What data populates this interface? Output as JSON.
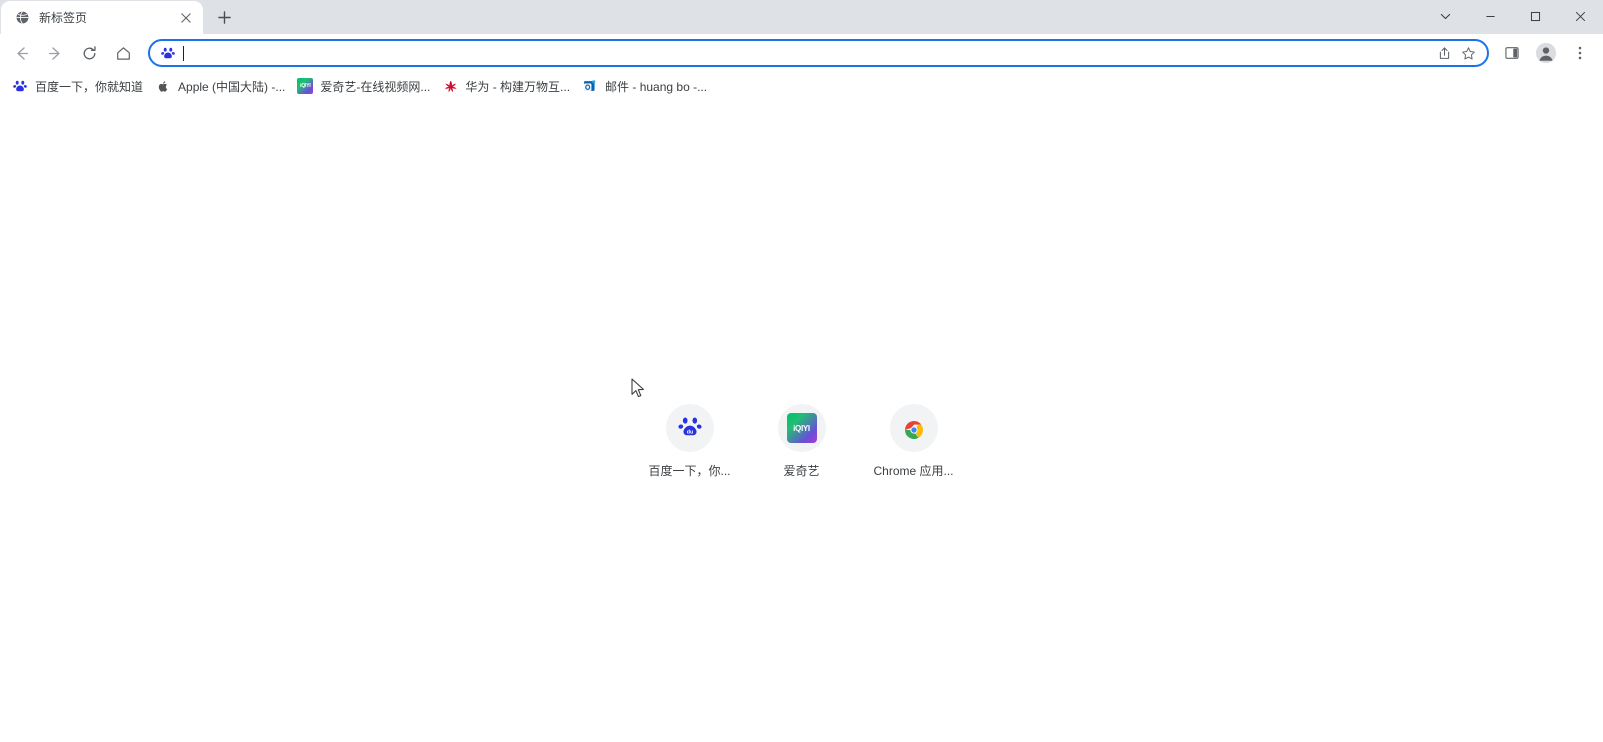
{
  "window": {
    "controls": {
      "tab_search": "tab-search-chevron",
      "minimize": "minimize",
      "maximize": "maximize",
      "close": "close"
    }
  },
  "tabstrip": {
    "tabs": [
      {
        "title": "新标签页",
        "favicon": "globe-icon",
        "active": true,
        "close_label": "×"
      }
    ],
    "new_tab_label": "+"
  },
  "toolbar": {
    "back_label": "←",
    "forward_label": "→",
    "reload_label": "⟳",
    "home_label": "⌂",
    "omnibox": {
      "value": "",
      "placeholder": "",
      "favicon": "baidu-paw-icon",
      "share_label": "share-icon",
      "bookmark_label": "star-icon"
    },
    "side_panel_label": "side-panel-icon",
    "profile_label": "profile-avatar-icon",
    "menu_label": "three-dot-menu-icon"
  },
  "bookmarks": [
    {
      "label": "百度一下，你就知道",
      "icon": "baidu-paw-icon"
    },
    {
      "label": "Apple (中国大陆) -...",
      "icon": "apple-icon"
    },
    {
      "label": "爱奇艺-在线视频网...",
      "icon": "iqiyi-icon"
    },
    {
      "label": "华为 - 构建万物互...",
      "icon": "huawei-icon"
    },
    {
      "label": "邮件 - huang bo -...",
      "icon": "outlook-icon"
    }
  ],
  "newtab": {
    "shortcuts": [
      {
        "label": "百度一下，你...",
        "icon": "baidu-paw-icon"
      },
      {
        "label": "爱奇艺",
        "icon": "iqiyi-icon"
      },
      {
        "label": "Chrome 应用...",
        "icon": "chrome-logo-icon"
      }
    ]
  },
  "colors": {
    "tabstrip_bg": "#dee1e6",
    "omnibox_focus": "#1a73e8",
    "baidu_blue": "#2932e1",
    "tile_bg": "#f1f3f4",
    "text": "#3c4043"
  }
}
